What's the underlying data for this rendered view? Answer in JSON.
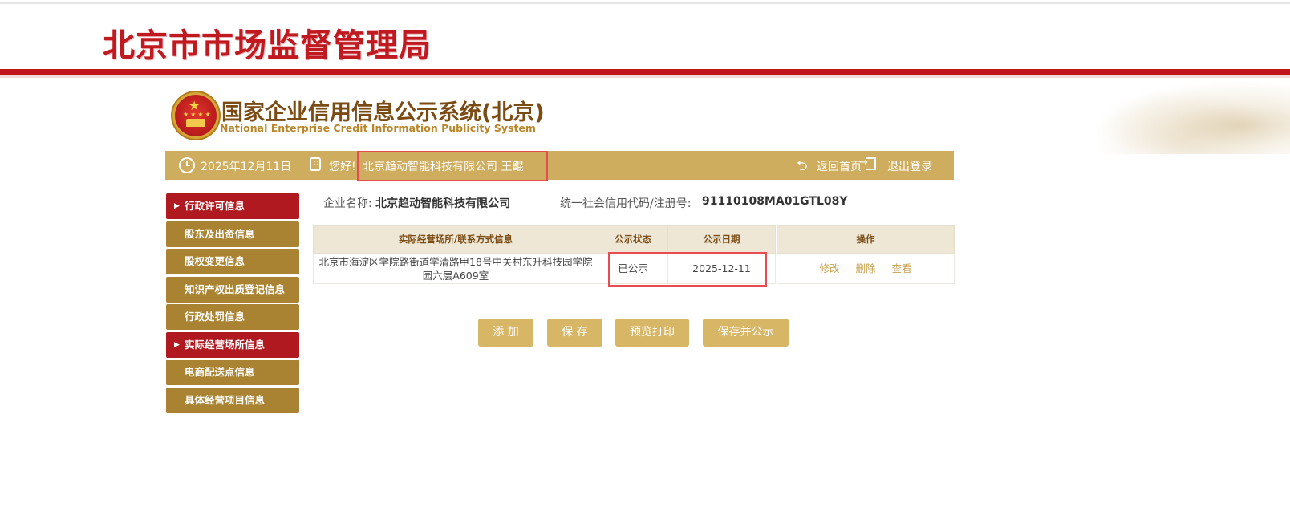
{
  "header": {
    "agency_title": "北京市市场监督管理局",
    "system_title": "国家企业信用信息公示系统(北京)",
    "system_subtitle": "National Enterprise Credit Information Publicity System"
  },
  "userbar": {
    "date": "2025年12月11日",
    "greeting": "您好!",
    "company_user": "北京趋动智能科技有限公司  王鲲",
    "home_link": "返回首页",
    "logout_link": "退出登录",
    "icons": [
      "clock-icon",
      "user-card-icon",
      "back-arrow-icon",
      "logout-icon"
    ]
  },
  "sidebar": {
    "items": [
      {
        "label": "行政许可信息",
        "active": true
      },
      {
        "label": "股东及出资信息",
        "active": false
      },
      {
        "label": "股权变更信息",
        "active": false
      },
      {
        "label": "知识产权出质登记信息",
        "active": false
      },
      {
        "label": "行政处罚信息",
        "active": false
      },
      {
        "label": "实际经营场所信息",
        "active": true
      },
      {
        "label": "电商配送点信息",
        "active": false
      },
      {
        "label": "具体经营项目信息",
        "active": false
      }
    ]
  },
  "company_info": {
    "name_label": "企业名称:",
    "name_value": "北京趋动智能科技有限公司",
    "code_label": "统一社会信用代码/注册号:",
    "code_value": "91110108MA01GTL08Y"
  },
  "table": {
    "headers": [
      "实际经营场所/联系方式信息",
      "公示状态",
      "公示日期",
      "操作"
    ],
    "rows": [
      {
        "address": "北京市海淀区学院路街道学清路甲18号中关村东升科技园学院园六层A609室",
        "status": "已公示",
        "date": "2025-12-11",
        "actions": [
          "修改",
          "删除",
          "查看"
        ]
      }
    ]
  },
  "buttons": {
    "add": "添 加",
    "save": "保 存",
    "preview_print": "预览打印",
    "save_publish": "保存并公示"
  },
  "colors": {
    "brand_red": "#c0151c",
    "gold_bar": "#cfad5e",
    "sidebar_gold": "#a98331",
    "sidebar_active": "#b0191f",
    "button_gold": "#d7b665",
    "highlight_box": "#e94b52"
  }
}
